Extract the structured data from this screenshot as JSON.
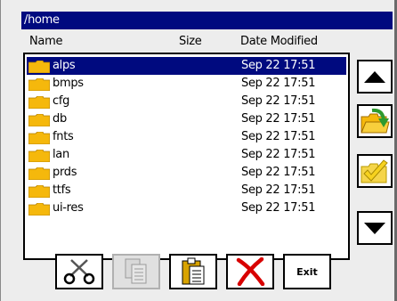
{
  "window": {
    "path": "/home"
  },
  "list": {
    "columns": {
      "name": "Name",
      "size": "Size",
      "date": "Date Modified"
    },
    "files": [
      {
        "name": "alps",
        "size": "",
        "date": "Sep 22 17:51",
        "selected": true
      },
      {
        "name": "bmps",
        "size": "",
        "date": "Sep 22 17:51"
      },
      {
        "name": "cfg",
        "size": "",
        "date": "Sep 22 17:51"
      },
      {
        "name": "db",
        "size": "",
        "date": "Sep 22 17:51"
      },
      {
        "name": "fnts",
        "size": "",
        "date": "Sep 22 17:51"
      },
      {
        "name": "lan",
        "size": "",
        "date": "Sep 22 17:51"
      },
      {
        "name": "prds",
        "size": "",
        "date": "Sep 22 17:51"
      },
      {
        "name": "ttfs",
        "size": "",
        "date": "Sep 22 17:51"
      },
      {
        "name": "ui-res",
        "size": "",
        "date": "Sep 22 17:51"
      }
    ]
  },
  "side_buttons": {
    "scroll_up": "triangle-up-icon",
    "open_folder": "folder-open-arrow-icon",
    "confirm": "folder-check-icon",
    "scroll_down": "triangle-down-icon"
  },
  "toolbar": {
    "cut": "scissors-icon",
    "copy": "copy-pages-icon",
    "paste": "clipboard-paste-icon",
    "delete": "red-x-icon",
    "exit_label": "Exit"
  },
  "colors": {
    "accent": "#000a7f",
    "folder": "#f5b80c",
    "arrow_green": "#2e9a2e",
    "check_yellow": "#f7d21e",
    "delete_red": "#d80000"
  }
}
